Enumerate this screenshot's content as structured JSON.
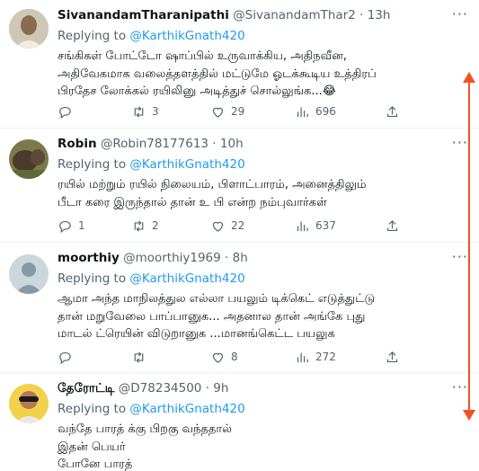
{
  "tweets": [
    {
      "name": "SivanandamTharanipathi",
      "handle": "@SivanandamThar2",
      "separator": "·",
      "time": "13h",
      "replying_prefix": "Replying to",
      "replying_to": "@KarthikGnath420",
      "text_lines": [
        "சங்கிகள் போட்டோ ஷாப்பில் உருவாக்கிய, அதிநவீன,",
        "அதிவேகமாக வலைத்தளத்தில் மட்டுமே ஓடக்கூடிய உத்திரப்",
        "பிரதேச லோக்கல் ரயிலினு அடித்துச் சொல்லுங்க...😂"
      ],
      "replies": "",
      "retweets": "3",
      "likes": "29",
      "views": "696"
    },
    {
      "name": "Robin",
      "handle": "@Robin78177613",
      "separator": "·",
      "time": "10h",
      "replying_prefix": "Replying to",
      "replying_to": "@KarthikGnath420",
      "text_lines": [
        "ரயில் மற்றும் ரயில்  நிலையம், பிளாட்பாரம், அனைத்திலும்",
        "பீடா கரை இருந்தால் தான்  உ பி என்ற நம்புவார்கள்"
      ],
      "replies": "1",
      "retweets": "2",
      "likes": "22",
      "views": "637"
    },
    {
      "name": "moorthiy",
      "handle": "@moorthiy1969",
      "separator": "·",
      "time": "8h",
      "replying_prefix": "Replying to",
      "replying_to": "@KarthikGnath420",
      "text_lines": [
        "ஆமா அந்த மாநிலத்துல எல்லா பயலும் டிக்கெட் எடுத்துட்டு",
        "தான் மறுவேலை பாப்பானுக... அதனால தான் அங்கே புது",
        "மாடல் ட்ரெயின் விடுறானுக ...மானங்கெட்ட பயலுக"
      ],
      "replies": "",
      "retweets": "",
      "likes": "8",
      "views": "272"
    },
    {
      "name": "தேரோட்டி",
      "handle": "@D78234500",
      "separator": "·",
      "time": "9h",
      "replying_prefix": "Replying to",
      "replying_to": "@KarthikGnath420",
      "text_lines": [
        "வந்தே பாரத் க்கு பிறகு வந்ததால்",
        "இதன் பெயர்",
        "போனே பாரத்"
      ]
    }
  ],
  "more_label": "···",
  "colors": {
    "link": "#1d9bf0",
    "secondary_text": "#536471",
    "annotation_arrow": "#f4511e"
  },
  "icons": [
    "reply-icon",
    "retweet-icon",
    "like-icon",
    "views-icon",
    "share-icon",
    "more-icon"
  ]
}
